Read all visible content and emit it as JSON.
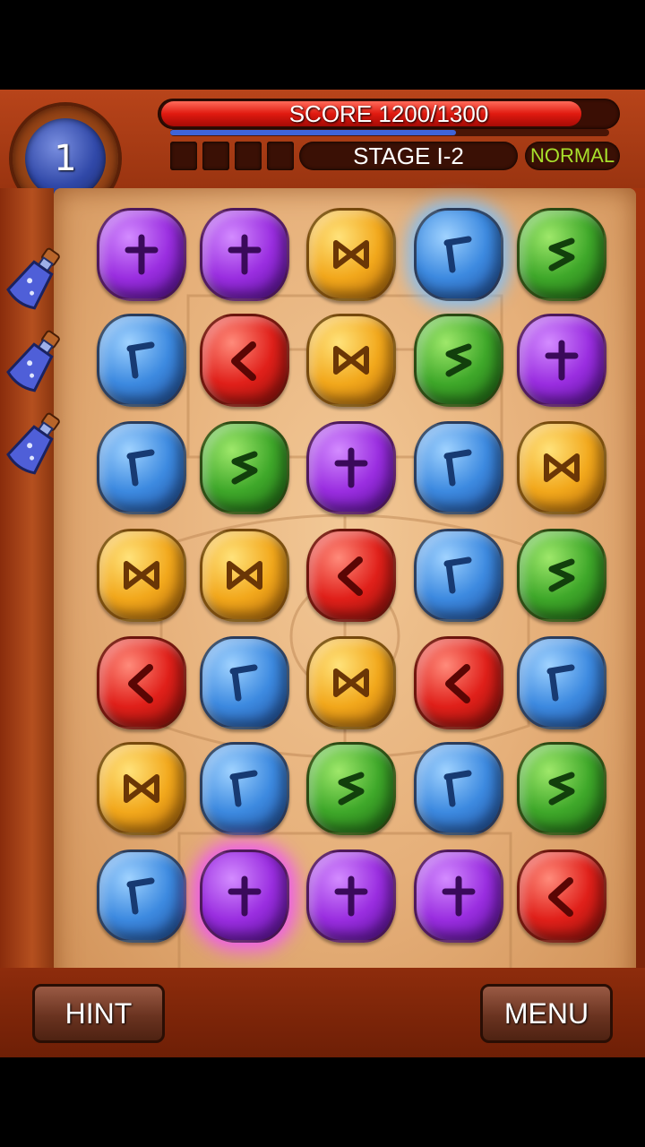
{
  "hud": {
    "level": "1",
    "score_text": "SCORE 1200/1300",
    "score_progress": 0.923,
    "xp_progress": 0.65,
    "stage": "STAGE I-2",
    "difficulty": "NORMAL",
    "empty_slots": 4
  },
  "potions": {
    "count": 3,
    "icon": "potion-bottle-icon"
  },
  "board": {
    "rows": 7,
    "cols": 5,
    "gems": [
      [
        "purple",
        "purple",
        "yellow",
        "blue",
        "green"
      ],
      [
        "blue",
        "red",
        "yellow",
        "green",
        "purple"
      ],
      [
        "blue",
        "green",
        "purple",
        "blue",
        "yellow"
      ],
      [
        "yellow",
        "yellow",
        "red",
        "blue",
        "green"
      ],
      [
        "red",
        "blue",
        "yellow",
        "red",
        "blue"
      ],
      [
        "yellow",
        "blue",
        "green",
        "blue",
        "green"
      ],
      [
        "blue",
        "purple",
        "purple",
        "purple",
        "red"
      ]
    ],
    "selected": [
      0,
      3
    ],
    "special": [
      6,
      1
    ]
  },
  "colors": {
    "purple": "#9a2ee0",
    "blue": "#3d8ae0",
    "yellow": "#f2a81c",
    "green": "#3fa82a",
    "red": "#e0201a",
    "score_fill": "#e01a10",
    "difficulty_text": "#a8e02c"
  },
  "buttons": {
    "hint": "HINT",
    "menu": "MENU"
  }
}
